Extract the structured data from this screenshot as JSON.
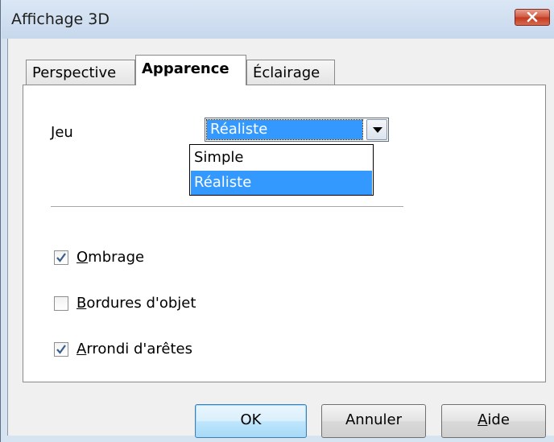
{
  "window": {
    "title": "Affichage 3D",
    "close_icon": "close-icon"
  },
  "tabs": [
    {
      "label": "Perspective",
      "active": false
    },
    {
      "label": "Apparence",
      "active": true
    },
    {
      "label": "Éclairage",
      "active": false
    }
  ],
  "jeu": {
    "label_accel": "J",
    "label_rest": "eu",
    "selected": "Réaliste",
    "options": [
      "Simple",
      "Réaliste"
    ]
  },
  "options": [
    {
      "accel": "O",
      "rest": "mbrage",
      "checked": true
    },
    {
      "accel": "B",
      "rest": "ordures d'objet",
      "checked": false
    },
    {
      "accel": "A",
      "rest": "rrondi d'arêtes",
      "checked": true
    }
  ],
  "buttons": {
    "ok": "OK",
    "cancel": "Annuler",
    "help_accel": "A",
    "help_rest": "ide"
  },
  "colors": {
    "selection": "#3399ff",
    "close_button": "#c1381f",
    "titlebar": "#d6e3f1"
  }
}
